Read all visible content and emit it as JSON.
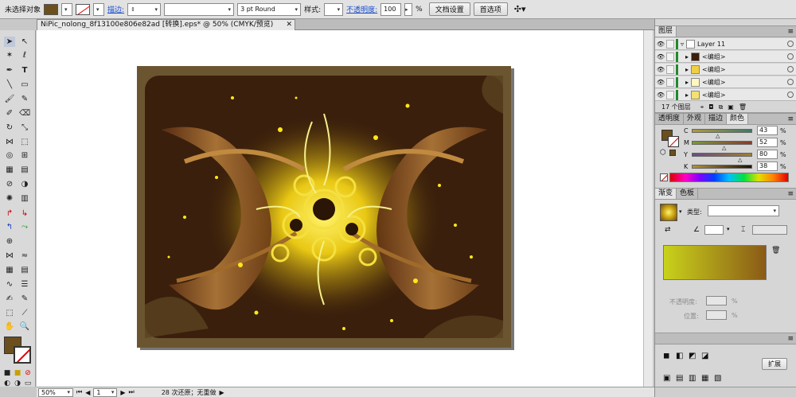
{
  "control_bar": {
    "selection": "未选择对象",
    "fill_color": "#6b4f1c",
    "stroke_label": "描边:",
    "brush_style": "3 pt Round",
    "style_label": "样式:",
    "opacity_label": "不透明度:",
    "opacity_value": "100",
    "percent": "%",
    "doc_setup": "文档设置",
    "preferences": "首选项"
  },
  "document": {
    "tab_title": "NiPic_nolong_8f13100e806e82ad  [转换].eps* @ 50% (CMYK/预览)",
    "close": "✕"
  },
  "status_bar": {
    "zoom": "50%",
    "artboard": "1",
    "undo_text": "28 次还原；无重做"
  },
  "layers_panel": {
    "title": "图层",
    "rows": [
      {
        "label": "Layer 11"
      },
      {
        "label": "<编组>"
      },
      {
        "label": "<编组>"
      },
      {
        "label": "<编组>"
      },
      {
        "label": "<编组>"
      }
    ],
    "count": "17 个图层"
  },
  "color_panel": {
    "tabs": [
      "透明度",
      "外观",
      "描边",
      "颜色"
    ],
    "channels": [
      {
        "name": "C",
        "value": "43"
      },
      {
        "name": "M",
        "value": "52"
      },
      {
        "name": "Y",
        "value": "80"
      },
      {
        "name": "K",
        "value": "38"
      }
    ],
    "percent": "%"
  },
  "gradient_panel": {
    "tabs": [
      "渐变",
      "色板"
    ],
    "type_label": "类型:",
    "percent": "%",
    "opacity_label": "不透明度:",
    "location_label": "位置:",
    "extend_button": "扩展"
  },
  "colors": {
    "accent_link": "#1a4fd0",
    "art_background": "#3a1f0c",
    "art_border": "#6b5530",
    "gradient_start": "#c9d21a",
    "gradient_end": "#8a5a18"
  }
}
